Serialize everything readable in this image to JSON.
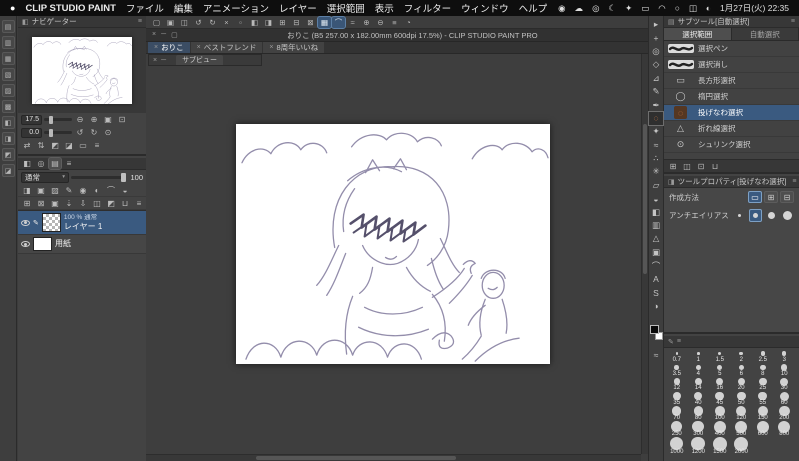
{
  "menubar": {
    "apple_glyph": "●",
    "app_name": "CLIP STUDIO PAINT",
    "menus": [
      "ファイル",
      "編集",
      "アニメーション",
      "レイヤー",
      "選択範囲",
      "表示",
      "フィルター",
      "ウィンドウ",
      "ヘルプ"
    ],
    "status_icons": [
      {
        "name": "paint-app-status-icon",
        "glyph": "◉"
      },
      {
        "name": "cloud-icon",
        "glyph": "☁"
      },
      {
        "name": "screen-record-icon",
        "glyph": "◎"
      },
      {
        "name": "moon-focus-icon",
        "glyph": "☾"
      },
      {
        "name": "bluetooth-icon",
        "glyph": "✦"
      },
      {
        "name": "battery-icon",
        "glyph": "▭"
      },
      {
        "name": "wifi-icon",
        "glyph": "◠"
      },
      {
        "name": "spotlight-search-icon",
        "glyph": "○"
      },
      {
        "name": "control-center-icon",
        "glyph": "◫"
      },
      {
        "name": "siri-icon",
        "glyph": "◐"
      }
    ],
    "clock": "1月27日(火) 22:35"
  },
  "left_strip": {
    "icons": [
      {
        "name": "quick-access-panel-icon",
        "glyph": "▤"
      },
      {
        "name": "material-panel-icon",
        "glyph": "▥"
      },
      {
        "name": "material-color-pattern-panel-icon",
        "glyph": "▦"
      },
      {
        "name": "material-monochrome-panel-icon",
        "glyph": "▧"
      },
      {
        "name": "material-manga-panel-icon",
        "glyph": "▨"
      },
      {
        "name": "material-image-panel-icon",
        "glyph": "▩"
      },
      {
        "name": "material-3d-panel-icon",
        "glyph": "◧"
      },
      {
        "name": "material-pose-panel-icon",
        "glyph": "◨"
      },
      {
        "name": "material-brush-panel-icon",
        "glyph": "◩"
      },
      {
        "name": "material-download-panel-icon",
        "glyph": "◪"
      }
    ]
  },
  "navigator": {
    "title": "ナビゲーター",
    "zoom": "17.5",
    "rotation": "0.0",
    "row1_icons": [
      {
        "name": "zoom-out-icon",
        "glyph": "⊖"
      },
      {
        "name": "zoom-in-icon",
        "glyph": "⊕"
      },
      {
        "name": "fit-to-screen-icon",
        "glyph": "▣"
      },
      {
        "name": "actual-size-icon",
        "glyph": "⊡"
      }
    ],
    "row2_icons": [
      {
        "name": "rotate-left-icon",
        "glyph": "↺"
      },
      {
        "name": "rotate-right-icon",
        "glyph": "↻"
      },
      {
        "name": "reset-rotation-icon",
        "glyph": "⊙"
      }
    ],
    "row3_icons": [
      {
        "name": "flip-horizontal-icon",
        "glyph": "⇄"
      },
      {
        "name": "flip-vertical-icon",
        "glyph": "⇅"
      },
      {
        "name": "rotate-90-left-icon",
        "glyph": "◩"
      },
      {
        "name": "rotate-90-right-icon",
        "glyph": "◪"
      },
      {
        "name": "fit-canvas-icon",
        "glyph": "▭"
      },
      {
        "name": "navigator-menu-icon",
        "glyph": "≡"
      }
    ]
  },
  "layers": {
    "tab_icons": [
      {
        "name": "layer-property-tab-icon",
        "glyph": "◧"
      },
      {
        "name": "layer-search-tab-icon",
        "glyph": "◎"
      },
      {
        "name": "layer-list-tab-icon",
        "glyph": "▤",
        "active": true
      },
      {
        "name": "layer-palette-menu-icon",
        "glyph": "≡"
      }
    ],
    "blend_mode": "通常",
    "opacity": "100",
    "effect_icons": [
      {
        "name": "clip-to-layer-below-icon",
        "glyph": "◨"
      },
      {
        "name": "lock-layer-icon",
        "glyph": "▣"
      },
      {
        "name": "lock-transparent-pixels-icon",
        "glyph": "▨"
      },
      {
        "name": "draft-layer-icon",
        "glyph": "✎"
      },
      {
        "name": "reference-layer-icon",
        "glyph": "◉"
      },
      {
        "name": "enable-mask-icon",
        "glyph": "◐"
      },
      {
        "name": "layer-ruler-icon",
        "glyph": "⌒"
      },
      {
        "name": "layer-color-icon",
        "glyph": "◒"
      }
    ],
    "cmd_icons": [
      {
        "name": "new-raster-layer-icon",
        "glyph": "⊞"
      },
      {
        "name": "new-vector-layer-icon",
        "glyph": "⊠"
      },
      {
        "name": "new-folder-icon",
        "glyph": "▣"
      },
      {
        "name": "transfer-to-lower-icon",
        "glyph": "⇣"
      },
      {
        "name": "merge-with-lower-icon",
        "glyph": "⇩"
      },
      {
        "name": "create-mask-icon",
        "glyph": "◫"
      },
      {
        "name": "apply-mask-icon",
        "glyph": "◩"
      },
      {
        "name": "delete-layer-icon",
        "glyph": "⊔"
      },
      {
        "name": "layer-menu-icon",
        "glyph": "≡"
      }
    ],
    "list": [
      {
        "info": "100 % 通常",
        "name": "レイヤー 1",
        "selected": true,
        "checker": true,
        "eye": true
      },
      {
        "name": "用紙",
        "paper": true,
        "eye": true
      }
    ]
  },
  "cmdbar": {
    "icons": [
      {
        "name": "new-file-icon",
        "glyph": "▢"
      },
      {
        "name": "open-file-icon",
        "glyph": "▣"
      },
      {
        "name": "save-file-icon",
        "glyph": "◫"
      },
      {
        "name": "undo-icon",
        "glyph": "↺"
      },
      {
        "name": "redo-icon",
        "glyph": "↻"
      },
      {
        "name": "clear-icon",
        "glyph": "×"
      },
      {
        "name": "deselect-icon",
        "glyph": "▫"
      },
      {
        "name": "invert-selection-icon",
        "glyph": "◧"
      },
      {
        "name": "crop-selection-icon",
        "glyph": "◨"
      },
      {
        "name": "selection-new-icon",
        "glyph": "⊞"
      },
      {
        "name": "selection-subtract-icon",
        "glyph": "⊟"
      },
      {
        "name": "selection-add-icon",
        "glyph": "⊠"
      },
      {
        "name": "snap-to-ruler-icon",
        "glyph": "▦",
        "active": true
      },
      {
        "name": "snap-to-special-ruler-icon",
        "glyph": "⌒",
        "active": true
      },
      {
        "name": "smooth-view-icon",
        "glyph": "≈"
      },
      {
        "name": "zoom-in-view-icon",
        "glyph": "⊕"
      },
      {
        "name": "zoom-out-view-icon",
        "glyph": "⊖"
      },
      {
        "name": "display-menu-icon",
        "glyph": "≡"
      },
      {
        "name": "rotate-view-icon",
        "glyph": "◔"
      }
    ]
  },
  "doc": {
    "window_controls": [
      {
        "name": "close-document-icon",
        "glyph": "×"
      },
      {
        "name": "minimize-document-icon",
        "glyph": "─"
      },
      {
        "name": "maximize-document-icon",
        "glyph": "▢"
      }
    ],
    "title": "おりこ (B5 257.00 x 182.00mm 600dpi 17.5%) - CLIP STUDIO PAINT PRO",
    "tabs": [
      {
        "label": "おりこ",
        "active": true
      },
      {
        "label": "ベストフレンド"
      },
      {
        "label": "8周年いいね"
      }
    ],
    "subview_controls": [
      {
        "name": "close-subview-icon",
        "glyph": "×"
      },
      {
        "name": "minimize-subview-icon",
        "glyph": "─"
      }
    ],
    "subview_label": "サブビュー"
  },
  "right_strip": {
    "tools": [
      {
        "name": "operation-tool-icon",
        "glyph": "▸"
      },
      {
        "name": "layer-move-tool-icon",
        "glyph": "+"
      },
      {
        "name": "zoom-tool-icon",
        "glyph": "◎"
      },
      {
        "name": "move-view-tool-icon",
        "glyph": "◇"
      },
      {
        "name": "eyedropper-tool-icon",
        "glyph": "⊿"
      },
      {
        "name": "pen-tool-icon",
        "glyph": "✎"
      },
      {
        "name": "pencil-tool-icon",
        "glyph": "✒"
      },
      {
        "name": "selection-tool-icon",
        "glyph": "◌",
        "selected": true
      },
      {
        "name": "auto-select-tool-icon",
        "glyph": "✦"
      },
      {
        "name": "paintbrush-tool-icon",
        "glyph": "≈"
      },
      {
        "name": "airbrush-tool-icon",
        "glyph": "∴"
      },
      {
        "name": "decoration-tool-icon",
        "glyph": "✳"
      },
      {
        "name": "eraser-tool-icon",
        "glyph": "▱"
      },
      {
        "name": "blend-tool-icon",
        "glyph": "◒"
      },
      {
        "name": "fill-tool-icon",
        "glyph": "◧"
      },
      {
        "name": "gradient-tool-icon",
        "glyph": "▥"
      },
      {
        "name": "figure-tool-icon",
        "glyph": "△"
      },
      {
        "name": "frame-border-tool-icon",
        "glyph": "▣"
      },
      {
        "name": "ruler-tool-icon",
        "glyph": "⌒"
      },
      {
        "name": "text-tool-icon",
        "glyph": "A"
      },
      {
        "name": "line-correction-tool-icon",
        "glyph": "S"
      },
      {
        "name": "lightness-tool-icon",
        "glyph": "◑"
      }
    ]
  },
  "subtool": {
    "title": "サブツール[自動選択]",
    "tabs": [
      {
        "label": "選択範囲",
        "active": true
      },
      {
        "label": "自動選択"
      }
    ],
    "items": [
      {
        "label": "選択ペン",
        "stroke": true
      },
      {
        "label": "選択消し",
        "stroke": true
      },
      {
        "label": "長方形選択",
        "glyph": "▭"
      },
      {
        "label": "楕円選択",
        "glyph": "◯"
      },
      {
        "label": "投げなわ選択",
        "glyph": "◌",
        "selected": true,
        "orange": true
      },
      {
        "label": "折れ線選択",
        "glyph": "△"
      },
      {
        "label": "シュリンク選択",
        "glyph": "⊙"
      }
    ],
    "footer_icons": [
      {
        "name": "subtool-add-icon",
        "glyph": "⊞"
      },
      {
        "name": "subtool-duplicate-icon",
        "glyph": "◫"
      },
      {
        "name": "subtool-settings-icon",
        "glyph": "⊡"
      },
      {
        "name": "subtool-delete-icon",
        "glyph": "⊔"
      }
    ]
  },
  "toolprop": {
    "title": "ツールプロパティ[投げなわ選択]",
    "rows": [
      {
        "label": "作成方法"
      },
      {
        "label": "アンチエイリアス"
      }
    ],
    "creation_methods": [
      {
        "name": "create-new-selection-icon",
        "glyph": "▭",
        "active": true
      },
      {
        "name": "add-to-selection-icon",
        "glyph": "⊞"
      },
      {
        "name": "remove-from-selection-icon",
        "glyph": "⊟"
      }
    ]
  },
  "brush_sizes": {
    "header_icons": [
      {
        "name": "brush-size-pencil-icon",
        "glyph": "✎"
      },
      {
        "name": "brush-size-menu-icon",
        "glyph": "≡"
      }
    ],
    "values": [
      "0.7",
      "1",
      "1.5",
      "2",
      "2.5",
      "3",
      "3.5",
      "4",
      "5",
      "6",
      "8",
      "10",
      "12",
      "14",
      "16",
      "20",
      "25",
      "30",
      "35",
      "40",
      "45",
      "50",
      "55",
      "60",
      "70",
      "80",
      "100",
      "120",
      "150",
      "200",
      "250",
      "300",
      "400",
      "500",
      "600",
      "800",
      "1000",
      "1200",
      "1500",
      "2000"
    ]
  },
  "colors": {
    "foreground": "#000000",
    "background": "#ffffff",
    "selection_accent": "#3a5a80",
    "tool_accent_orange": "#ef8a4b"
  }
}
